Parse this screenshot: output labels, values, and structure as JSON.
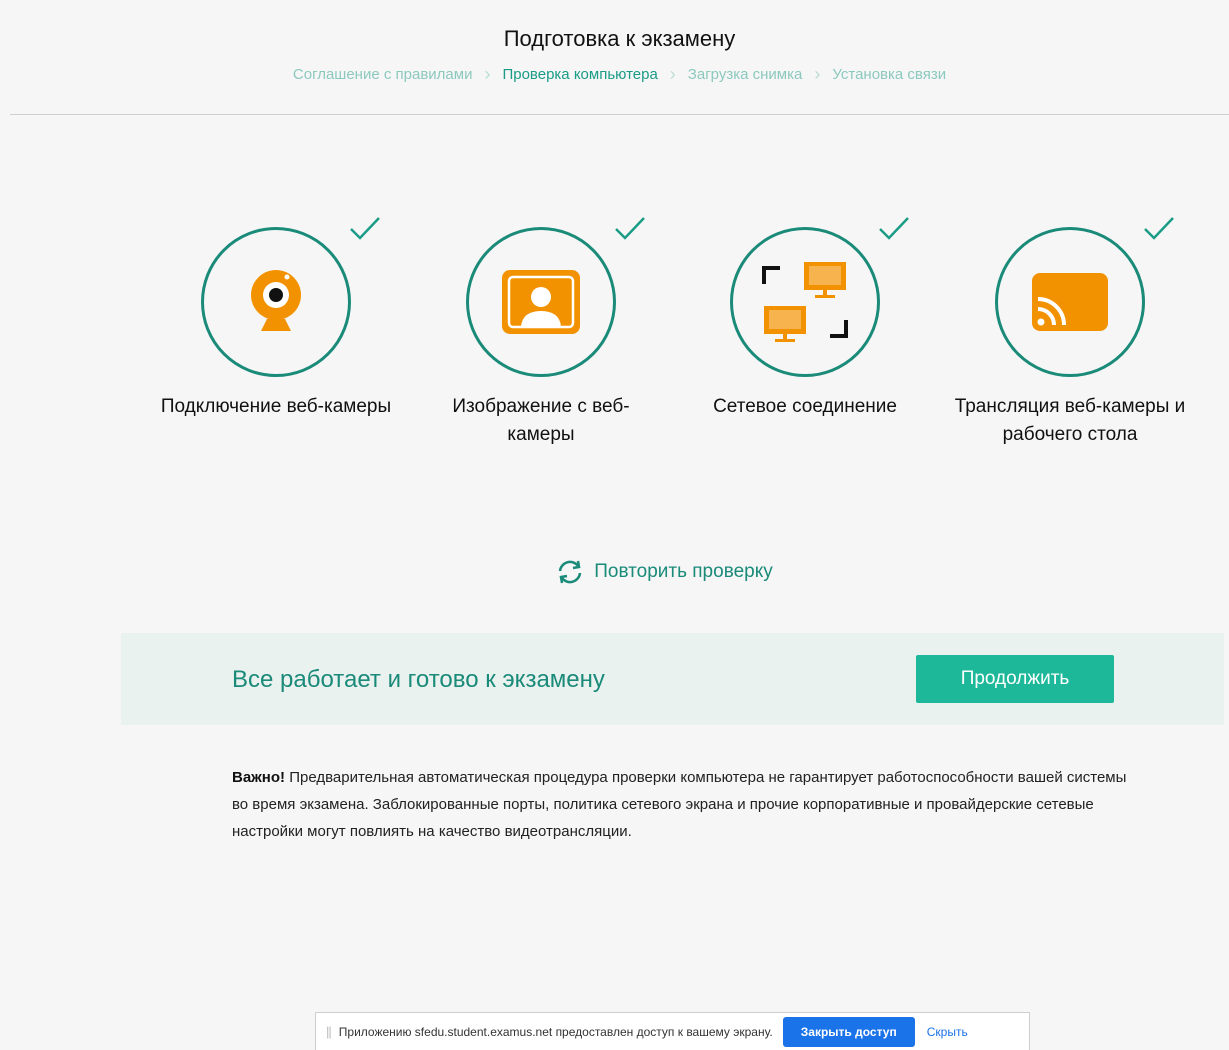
{
  "header": {
    "title": "Подготовка к экзамену",
    "breadcrumb": [
      {
        "label": "Соглашение с правилами",
        "state": "done"
      },
      {
        "label": "Проверка компьютера",
        "state": "active"
      },
      {
        "label": "Загрузка снимка",
        "state": "pending"
      },
      {
        "label": "Установка связи",
        "state": "pending"
      }
    ]
  },
  "checks": [
    {
      "label": "Подключение веб-камеры",
      "icon": "webcam-icon",
      "status": "passed"
    },
    {
      "label": "Изображение с веб-камеры",
      "icon": "user-image-icon",
      "status": "passed"
    },
    {
      "label": "Сетевое соединение",
      "icon": "network-icon",
      "status": "passed"
    },
    {
      "label": "Трансляция веб-камеры и рабочего стола",
      "icon": "cast-icon",
      "status": "passed"
    }
  ],
  "retry": {
    "label": "Повторить проверку",
    "icon": "refresh-icon"
  },
  "banner": {
    "message": "Все работает и готово к экзамену",
    "button_label": "Продолжить"
  },
  "note": {
    "bold": "Важно!",
    "text": " Предварительная автоматическая процедура проверки компьютера не гарантирует работоспособности вашей системы во время экзамена. Заблокированные порты, политика сетевого экрана и прочие корпоративные и провайдерские сетевые настройки могут повлиять на качество видеотрансляции."
  },
  "share_bar": {
    "text": "Приложению sfedu.student.examus.net предоставлен доступ к вашему экрану.",
    "stop_label": "Закрыть доступ",
    "hide_label": "Скрыть"
  },
  "colors": {
    "accent": "#1a8a79",
    "button": "#1db89a",
    "icon": "#f39200",
    "chrome_blue": "#1a73e8"
  }
}
